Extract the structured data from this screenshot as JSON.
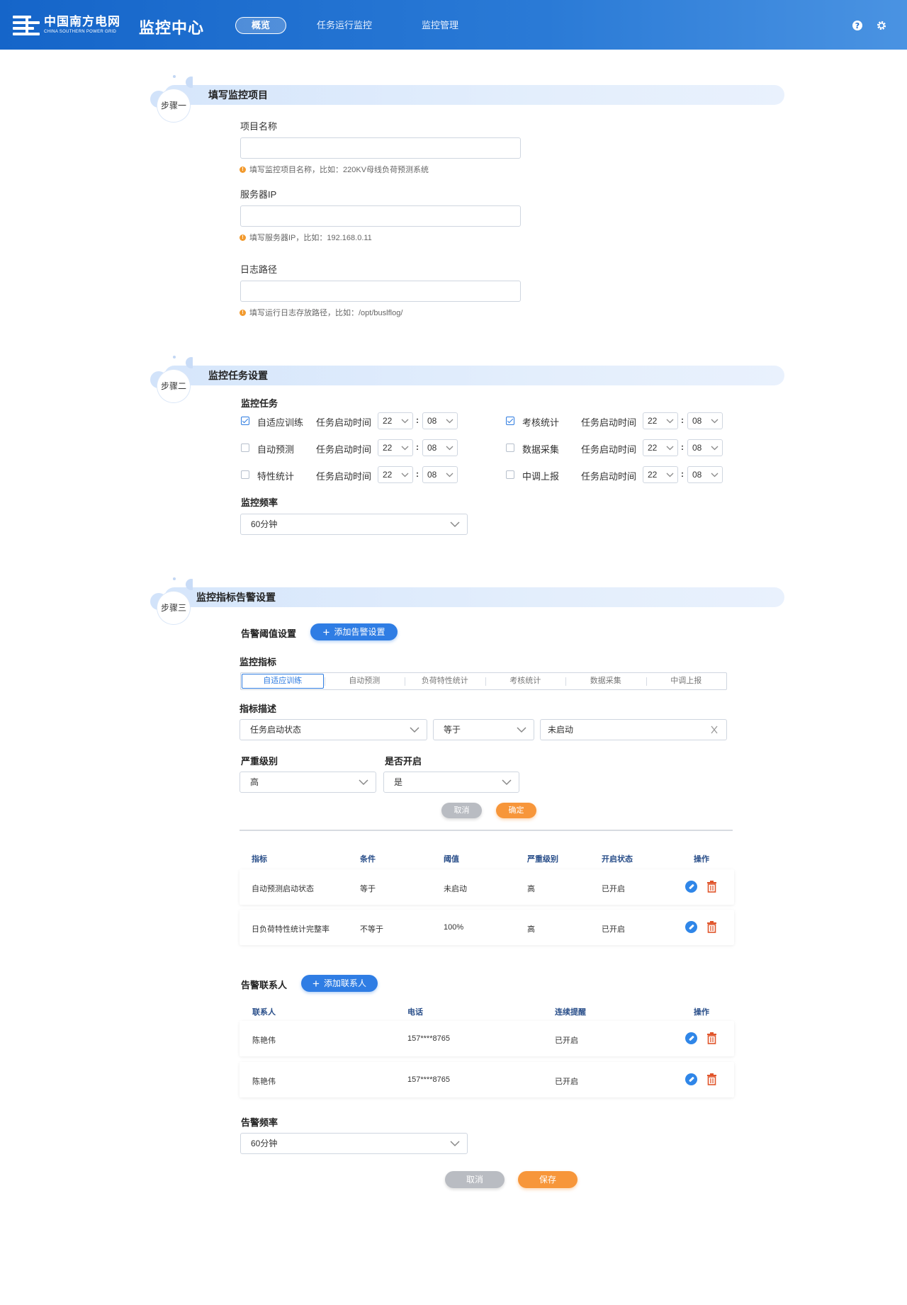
{
  "header": {
    "logo_cn": "中国南方电网",
    "logo_en": "CHINA SOUTHERN POWER GRID",
    "app_title": "监控中心",
    "nav": [
      "概览",
      "任务运行监控",
      "监控管理"
    ],
    "help_icon": "help-icon",
    "settings_icon": "gear-icon"
  },
  "step1": {
    "step_label": "步骤一",
    "title": "填写监控项目",
    "project_name_label": "项目名称",
    "project_name_hint": "填写监控项目名称，比如：220KV母线负荷预测系统",
    "server_ip_label": "服务器IP",
    "server_ip_hint": "填写服务器IP，比如：192.168.0.11",
    "log_path_label": "日志路径",
    "log_path_hint": "填写运行日志存放路径，比如：/opt/buslflog/"
  },
  "step2": {
    "step_label": "步骤二",
    "title": "监控任务设置",
    "tasks_label": "监控任务",
    "start_time_label": "任务启动时间",
    "tasks": [
      {
        "name": "自适应训练",
        "checked": true,
        "hour": "22",
        "minute": "08"
      },
      {
        "name": "考核统计",
        "checked": true,
        "hour": "22",
        "minute": "08"
      },
      {
        "name": "自动预测",
        "checked": false,
        "hour": "22",
        "minute": "08"
      },
      {
        "name": "数据采集",
        "checked": false,
        "hour": "22",
        "minute": "08"
      },
      {
        "name": "特性统计",
        "checked": false,
        "hour": "22",
        "minute": "08"
      },
      {
        "name": "中调上报",
        "checked": false,
        "hour": "22",
        "minute": "08"
      }
    ],
    "freq_label": "监控频率",
    "freq_value": "60分钟"
  },
  "step3": {
    "step_label": "步骤三",
    "title": "监控指标告警设置",
    "threshold_label": "告警阈值设置",
    "add_alarm_btn": "添加告警设置",
    "metric_label": "监控指标",
    "metric_tabs": [
      "自适应训练",
      "自动预测",
      "负荷特性统计",
      "考核统计",
      "数据采集",
      "中调上报"
    ],
    "desc_label": "指标描述",
    "desc_select": "任务启动状态",
    "cond_select": "等于",
    "value_input": "未启动",
    "severity_label": "严重级别",
    "severity_value": "高",
    "enabled_label": "是否开启",
    "enabled_value": "是",
    "cancel_btn": "取消",
    "confirm_btn": "确定",
    "rule_columns": [
      "指标",
      "条件",
      "阈值",
      "严重级别",
      "开启状态",
      "操作"
    ],
    "rules": [
      {
        "metric": "自动预测启动状态",
        "cond": "等于",
        "threshold": "未启动",
        "severity": "高",
        "status": "已开启"
      },
      {
        "metric": "日负荷特性统计完整率",
        "cond": "不等于",
        "threshold": "100%",
        "severity": "高",
        "status": "已开启"
      }
    ],
    "contact_label": "告警联系人",
    "add_contact_btn": "添加联系人",
    "contact_columns": [
      "联系人",
      "电话",
      "连续提醒",
      "操作"
    ],
    "contacts": [
      {
        "name": "陈艳伟",
        "phone": "157****8765",
        "remind": "已开启"
      },
      {
        "name": "陈艳伟",
        "phone": "157****8765",
        "remind": "已开启"
      }
    ],
    "alarm_freq_label": "告警频率",
    "alarm_freq_value": "60分钟",
    "cancel_btn2": "取消",
    "save_btn": "保存"
  },
  "colors": {
    "primary": "#2f7de4",
    "accent": "#f7963a",
    "header": "#1565c9",
    "delete": "#e0552b"
  }
}
